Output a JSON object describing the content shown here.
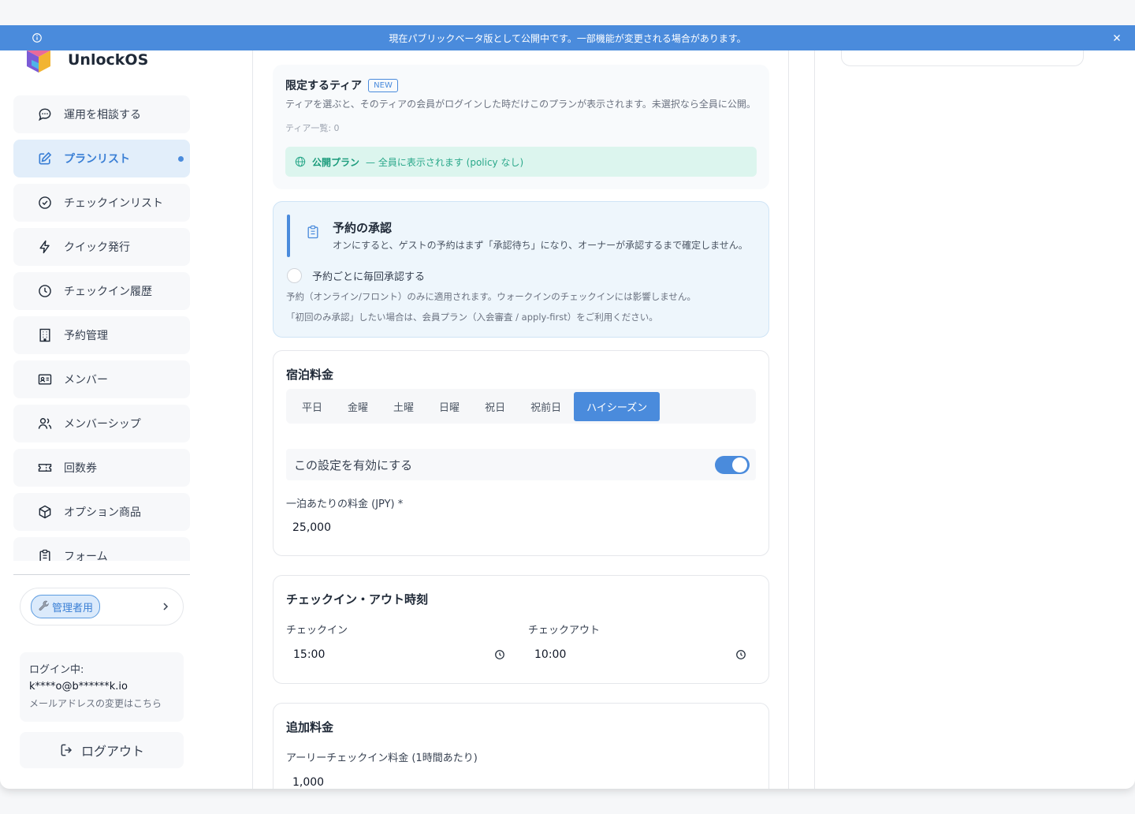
{
  "banner": {
    "text": "現在パブリックベータ版として公開中です。一部機能が変更される場合があります。"
  },
  "app": {
    "name": "UnlockOS"
  },
  "sidebar": {
    "items": [
      {
        "label": "運用を相談する",
        "icon": "chat-bubble-icon"
      },
      {
        "label": "プランリスト",
        "icon": "edit-icon",
        "active": true
      },
      {
        "label": "チェックインリスト",
        "icon": "check-circle-icon"
      },
      {
        "label": "クイック発行",
        "icon": "lightning-icon"
      },
      {
        "label": "チェックイン履歴",
        "icon": "clock-icon"
      },
      {
        "label": "予約管理",
        "icon": "building-icon"
      },
      {
        "label": "メンバー",
        "icon": "id-card-icon"
      },
      {
        "label": "メンバーシップ",
        "icon": "users-icon"
      },
      {
        "label": "回数券",
        "icon": "ticket-icon"
      },
      {
        "label": "オプション商品",
        "icon": "box-icon"
      },
      {
        "label": "フォーム",
        "icon": "clipboard-icon"
      }
    ],
    "admin_label": "管理者用",
    "login": {
      "label": "ログイン中:",
      "email": "k****o@b******k.io",
      "change_email": "メールアドレスの変更はこちら"
    },
    "logout_label": "ログアウト"
  },
  "tier": {
    "title": "限定するティア",
    "badge": "NEW",
    "description": "ティアを選ぶと、そのティアの会員がログインした時だけこのプランが表示されます。未選択なら全員に公開。",
    "count": "ティア一覧: 0",
    "public_label": "公開プラン",
    "public_note": "— 全員に表示されます (policy なし)"
  },
  "approval": {
    "title": "予約の承認",
    "description": "オンにすると、ゲストの予約はまず「承認待ち」になり、オーナーが承認するまで確定しません。",
    "option_label": "予約ごとに毎回承認する",
    "note1": "予約（オンライン/フロント）のみに適用されます。ウォークインのチェックインには影響しません。",
    "note2": "「初回のみ承認」したい場合は、会員プラン（入会審査 / apply-first）をご利用ください。"
  },
  "pricing": {
    "title": "宿泊料金",
    "tabs": [
      "平日",
      "金曜",
      "土曜",
      "日曜",
      "祝日",
      "祝前日",
      "ハイシーズン"
    ],
    "active_tab": "ハイシーズン",
    "enable_label": "この設定を有効にする",
    "enabled": true,
    "price_label": "一泊あたりの料金 (JPY) *",
    "price_value": "25,000"
  },
  "checkin_times": {
    "title": "チェックイン・アウト時刻",
    "checkin_label": "チェックイン",
    "checkin_value": "15:00",
    "checkout_label": "チェックアウト",
    "checkout_value": "10:00"
  },
  "extra_fees": {
    "title": "追加料金",
    "early_label": "アーリーチェックイン料金 (1時間あたり)",
    "early_value": "1,000"
  },
  "colors": {
    "accent": "#4a8bdc",
    "success_bg": "#dcf5ee",
    "success_text": "#2aa88a",
    "approval_bg": "#eef6fc"
  }
}
